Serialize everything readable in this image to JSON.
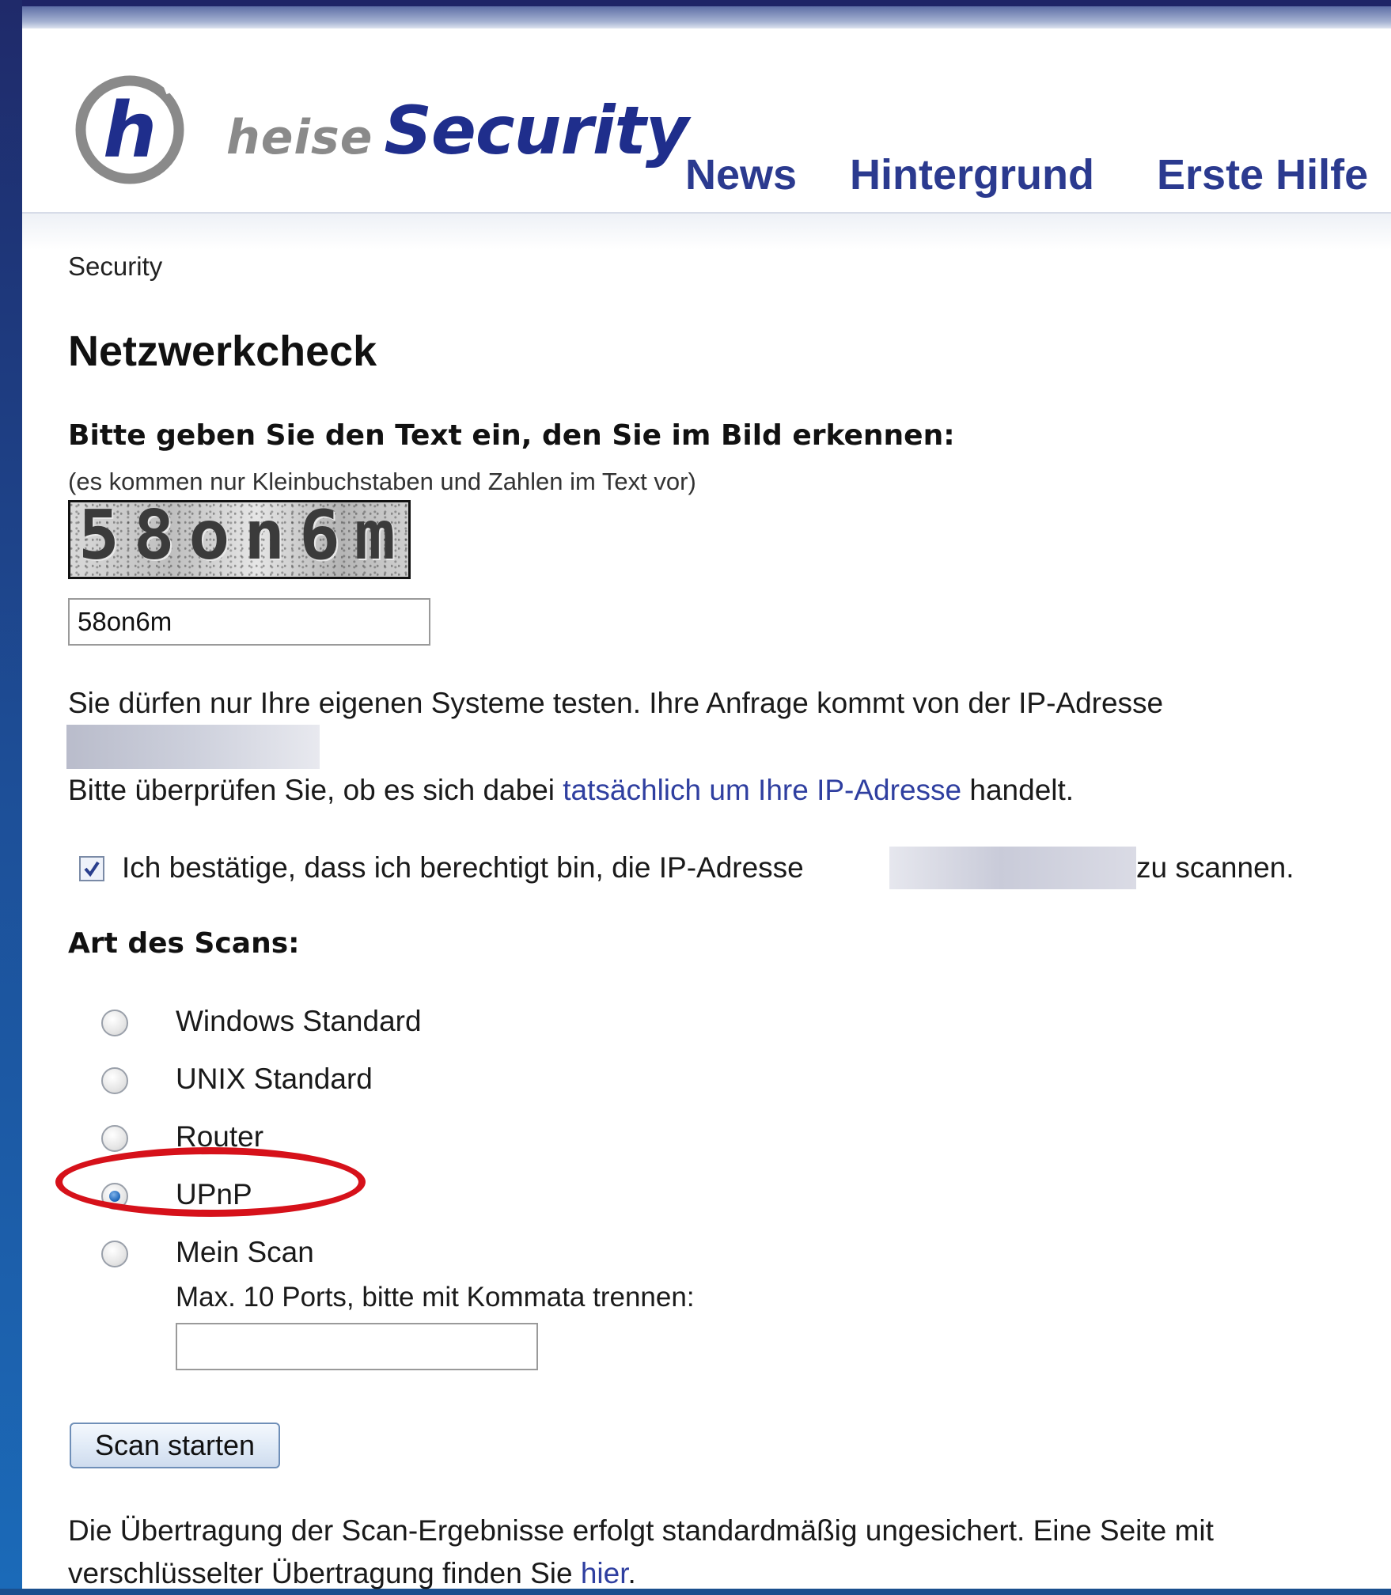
{
  "logo": {
    "word1": "heise",
    "word2": "Security",
    "emblem": "h"
  },
  "nav": {
    "items": [
      "News",
      "Hintergrund",
      "Erste Hilfe"
    ]
  },
  "breadcrumb": "Security",
  "page_title": "Netzwerkcheck",
  "captcha": {
    "heading": "Bitte geben Sie den Text ein, den Sie im Bild erkennen:",
    "hint": "(es kommen nur Kleinbuchstaben und Zahlen im Text vor)",
    "image_text": "58on6m",
    "input_value": "58on6m"
  },
  "ip_notice": {
    "text": "Sie dürfen nur Ihre eigenen Systeme testen. Ihre Anfrage kommt von der IP-Adresse",
    "verify_prefix": "Bitte überprüfen Sie, ob es sich dabei ",
    "verify_link": "tatsächlich um Ihre IP-Adresse",
    "verify_suffix": " handelt."
  },
  "confirm": {
    "checked": true,
    "text_before": "Ich bestätige, dass ich berechtigt bin, die IP-Adresse",
    "text_after": "zu scannen."
  },
  "scan_type": {
    "heading": "Art des Scans:",
    "options": [
      {
        "label": "Windows Standard",
        "checked": false
      },
      {
        "label": "UNIX Standard",
        "checked": false
      },
      {
        "label": "Router",
        "checked": false
      },
      {
        "label": "UPnP",
        "checked": true
      },
      {
        "label": "Mein Scan",
        "checked": false
      }
    ],
    "ports_hint": "Max. 10 Ports, bitte mit Kommata trennen:",
    "ports_value": ""
  },
  "scan_button": "Scan starten",
  "footer": {
    "text": "Die Übertragung der Scan-Ergebnisse erfolgt standardmäßig ungesichert. Eine Seite mit verschlüsselter Übertragung finden Sie ",
    "link": "hier",
    "end": "."
  },
  "colors": {
    "brand_blue": "#1f2e8c",
    "nav_blue": "#2b3a8f",
    "link_blue": "#2f3fa0",
    "highlight_red": "#d6111a",
    "logo_gray": "#8a8a8a"
  }
}
